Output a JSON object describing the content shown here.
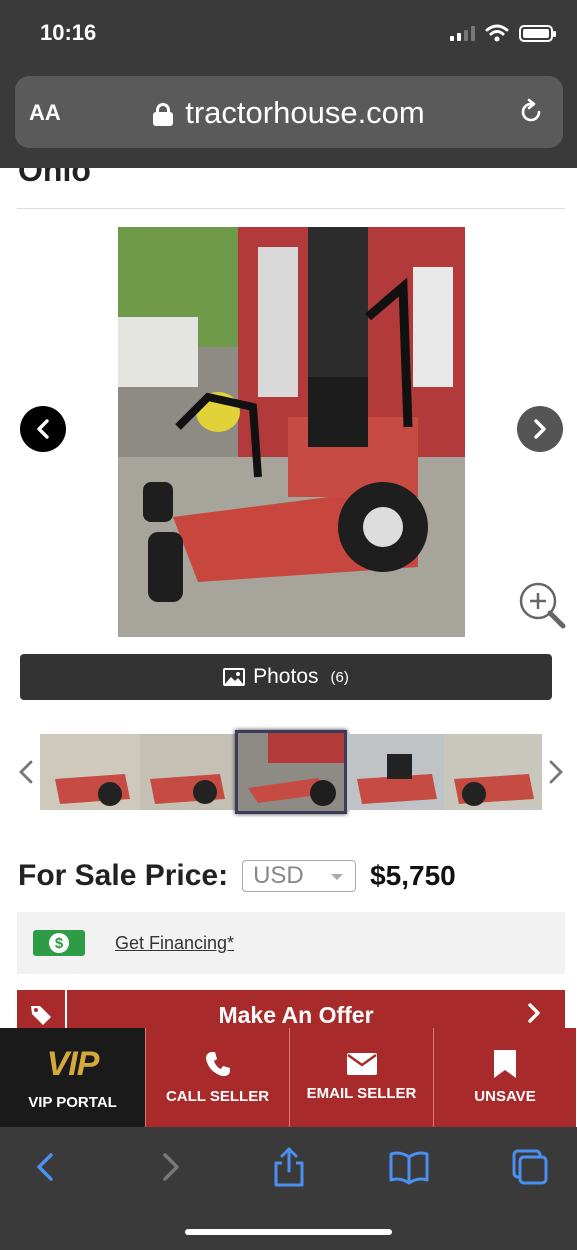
{
  "status_bar": {
    "time": "10:16"
  },
  "browser": {
    "text_size_label": "AA",
    "url": "tractorhouse.com"
  },
  "listing": {
    "partial_title": "Ohio",
    "photos_button": {
      "label": "Photos",
      "count": "(6)"
    },
    "price": {
      "label": "For Sale Price:",
      "currency": "USD",
      "value": "$5,750"
    },
    "financing_link": "Get Financing*",
    "make_offer": "Make An Offer"
  },
  "action_bar": {
    "vip_logo": "VIP",
    "items": [
      {
        "label": "VIP PORTAL",
        "icon": "vip-logo"
      },
      {
        "label": "CALL SELLER",
        "icon": "phone-icon"
      },
      {
        "label": "EMAIL SELLER",
        "icon": "envelope-icon"
      },
      {
        "label": "UNSAVE",
        "icon": "bookmark-icon"
      }
    ]
  },
  "colors": {
    "chrome": "#3a3a3a",
    "brand_red": "#a82a2b",
    "finance_green": "#2e9b45",
    "vip_gold": "#d4a93a"
  }
}
